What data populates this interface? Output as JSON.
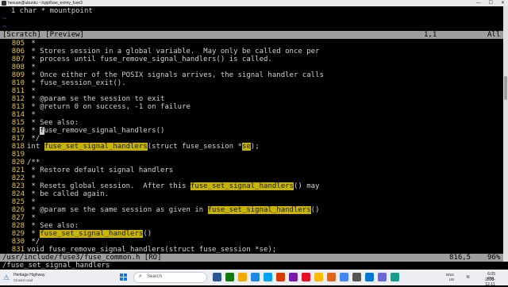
{
  "window": {
    "title": "hexuan@ubuntu: ~/cpp/fuse_ex/my_fuse3"
  },
  "top_pane": {
    "lines": [
      "  1 char * mountpoint",
      "~",
      "~"
    ]
  },
  "status_top": {
    "left": "[Scratch] [Preview]",
    "position": "1,1",
    "scroll": "All"
  },
  "code": {
    "lines": [
      {
        "num": "805",
        "text": " *"
      },
      {
        "num": "806",
        "text": " * Stores session in a global variable.  May only be called once per"
      },
      {
        "num": "807",
        "text": " * process until fuse_remove_signal_handlers() is called."
      },
      {
        "num": "808",
        "text": " *"
      },
      {
        "num": "809",
        "text": " * Once either of the POSIX signals arrives, the signal handler calls"
      },
      {
        "num": "810",
        "text": " * fuse_session_exit()."
      },
      {
        "num": "811",
        "text": " *"
      },
      {
        "num": "812",
        "text": " * @param se the session to exit"
      },
      {
        "num": "813",
        "text": " * @return 0 on success, -1 on failure"
      },
      {
        "num": "814",
        "text": " *"
      },
      {
        "num": "815",
        "text": " * See also:"
      },
      {
        "num": "816",
        "pre": " * ",
        "cursor": "f",
        "text": "use_remove_signal_handlers()"
      },
      {
        "num": "817",
        "text": " */"
      },
      {
        "num": "818",
        "pre": "int ",
        "hl": "fuse_set_signal_handlers",
        "mid": "(struct fuse_session *",
        "hl2": "se",
        "post": ");"
      },
      {
        "num": "819",
        "text": ""
      },
      {
        "num": "820",
        "text": "/**"
      },
      {
        "num": "821",
        "text": " * Restore default signal handlers"
      },
      {
        "num": "822",
        "text": " *"
      },
      {
        "num": "823",
        "pre": " * Resets global session.  After this ",
        "hl": "fuse_set_signal_handlers",
        "post": "() may"
      },
      {
        "num": "824",
        "text": " * be called again."
      },
      {
        "num": "825",
        "text": " *"
      },
      {
        "num": "826",
        "pre": " * @param se the same session as given in ",
        "hl": "fuse_set_signal_handlers",
        "post": "()"
      },
      {
        "num": "827",
        "text": " *"
      },
      {
        "num": "828",
        "text": " * See also:"
      },
      {
        "num": "829",
        "pre": " * ",
        "hl": "fuse_set_signal_handlers",
        "post": "()"
      },
      {
        "num": "830",
        "text": " */"
      },
      {
        "num": "831",
        "text": "void fuse_remove_signal_handlers(struct fuse_session *se);"
      }
    ]
  },
  "status_bottom": {
    "left": "/usr/include/fuse3/fuse_common.h [RO]",
    "position": "816,5",
    "scroll": "96%"
  },
  "cmdline": "/fuse_set_signal_handlers",
  "taskbar": {
    "weather_title": "Heritage Highway",
    "weather_sub": "Closed road",
    "search_placeholder": "Search",
    "lang_top": "ENG",
    "lang_bottom": "US",
    "time": "6:05 PM",
    "date": "2023-12-11",
    "app_colors": [
      "#2b5797",
      "#0f7b0f",
      "#f2a900",
      "#1e88e5",
      "#00a4ef",
      "#d83b01",
      "#7719aa",
      "#e81123",
      "#ffb900",
      "#e0671a",
      "#4285f4",
      "#555555",
      "#0078d4",
      "#6b69d6",
      "#1a9c8f"
    ]
  }
}
